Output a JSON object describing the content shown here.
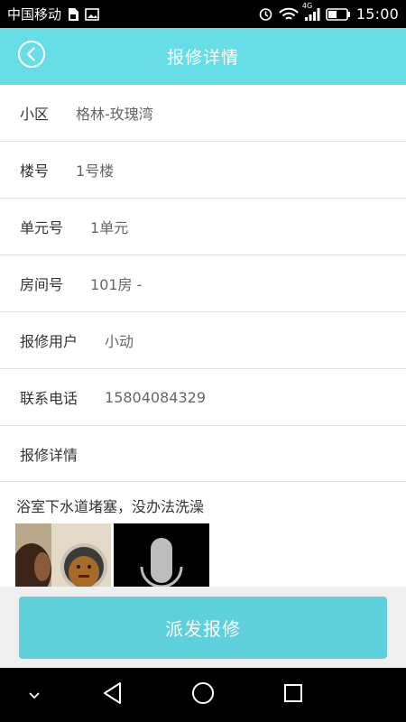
{
  "status_bar": {
    "carrier": "中国移动",
    "network": "4G",
    "time": "15:00",
    "icons": [
      "sim-card-icon",
      "image-icon",
      "alarm-icon",
      "wifi-icon",
      "signal-icon",
      "battery-icon"
    ]
  },
  "header": {
    "title": "报修详情",
    "back_icon": "back-arrow-icon",
    "background": "#67dde6"
  },
  "details": [
    {
      "label": "小区",
      "value": "格林-玫瑰湾"
    },
    {
      "label": "楼号",
      "value": "1号楼"
    },
    {
      "label": "单元号",
      "value": "1单元"
    },
    {
      "label": "房间号",
      "value": "101房 -"
    },
    {
      "label": "报修用户",
      "value": "小动"
    },
    {
      "label": "联系电话",
      "value": "15804084329"
    }
  ],
  "repair_detail": {
    "title": "报修详情",
    "description": "浴室下水道堵塞，没办法洗澡",
    "attachments": [
      "photo-thumbnail",
      "voice-thumbnail"
    ]
  },
  "dispatch_button": {
    "label": "派发报修",
    "color": "#5ed0dc"
  },
  "nav_bar": {
    "icons": [
      "chevron-down-icon",
      "back-triangle-icon",
      "home-circle-icon",
      "recents-square-icon"
    ]
  }
}
